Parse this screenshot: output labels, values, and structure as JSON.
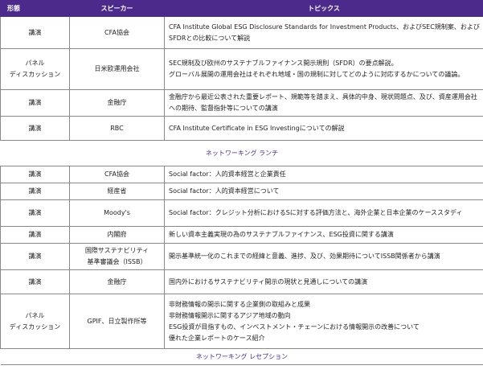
{
  "header": {
    "col1": "形態",
    "col2": "スピーカー",
    "col3": "トピックス"
  },
  "session1": [
    {
      "type": "講演",
      "speaker": "CFA協会",
      "topic": "CFA Institute Global ESG Disclosure Standards for Investment Products、およびSEC規制案、およびSFDRとの比較について解説"
    },
    {
      "type": "パネル\nディスカッション",
      "speaker": "日米欧運用会社",
      "topic": "SEC規制及び欧州のサステナブルファイナンス開示規則（SFDR）の要点解説。\nグローバル展開の運用会社はそれぞれ地域・国の規制に対してどのように対応するかについての議論。"
    },
    {
      "type": "講演",
      "speaker": "金融庁",
      "topic": "金融庁から最近公表された重要レポート、規範等を踏まえ、具体的中身、現状問題点、及び、資産運用会社への期待、監督指針等についての講演"
    },
    {
      "type": "講演",
      "speaker": "RBC",
      "topic": "CFA Institute Certificate in ESG Investingについての解説"
    }
  ],
  "break1": "ネットワーキング ランチ",
  "session2": [
    {
      "type": "講演",
      "speaker": "CFA協会",
      "topic": "Social factor：人的資本経営と企業責任"
    },
    {
      "type": "講演",
      "speaker": "経産省",
      "topic": "Social factor：人的資本経営について"
    },
    {
      "type": "講演",
      "speaker": "Moody's",
      "topic": "Social factor：クレジット分析におけるSに対する評価方法と、海外企業と日本企業のケーススタディ"
    },
    {
      "type": "講演",
      "speaker": "内閣府",
      "topic": "新しい資本主義実現の為のサステナブルファイナンス、ESG投資に関する講演"
    },
    {
      "type": "講演",
      "speaker": "国際サステナビリティ\n基準審議会（ISSB）",
      "topic": "開示基準統一化のこれまでの経緯と意義、進捗、及び、効果期待についてISSB関係者から講演"
    },
    {
      "type": "講演",
      "speaker": "金融庁",
      "topic": "国内外におけるサステナビリティ開示の現状と見通しについての講演"
    },
    {
      "type": "パネル\nディスカッション",
      "speaker": "GPIF、日立製作所等",
      "topic": "非財務情報の開示に関する企業側の取組みと成果\n非財務情報開示に関するアジア地域の動向\nESG投資が目指すもの、インベストメント・チェーンにおける情報開示の改善について\n優れた企業レポートのケース紹介"
    }
  ],
  "break2": "ネットワーキング レセプション"
}
